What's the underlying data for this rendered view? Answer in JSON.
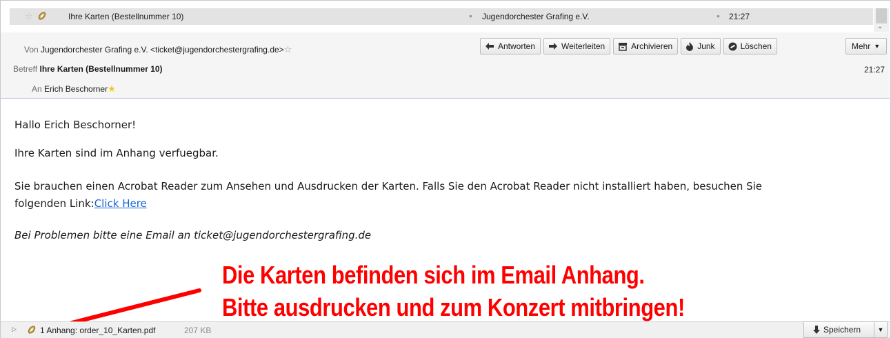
{
  "message_list": {
    "subject": "Ihre Karten (Bestellnummer 10)",
    "from": "Jugendorchester Grafing e.V.",
    "time": "21:27"
  },
  "header": {
    "from_label": "Von",
    "from_value": "Jugendorchester Grafing e.V. <ticket@jugendorchestergrafing.de>",
    "subject_label": "Betreff",
    "subject_value": "Ihre Karten (Bestellnummer 10)",
    "to_label": "An",
    "to_value": "Erich Beschorner",
    "time": "21:27"
  },
  "toolbar": {
    "reply": "Antworten",
    "forward": "Weiterleiten",
    "archive": "Archivieren",
    "junk": "Junk",
    "delete": "Löschen",
    "more": "Mehr"
  },
  "body": {
    "greeting": "Hallo Erich Beschorner!",
    "line1": "Ihre Karten sind im Anhang verfuegbar.",
    "line2a": "Sie brauchen einen Acrobat Reader zum Ansehen und Ausdrucken der Karten. Falls Sie den Acrobat Reader nicht installiert haben, besuchen Sie",
    "line2b": "folgenden Link:",
    "link_text": "Click Here",
    "problem": "Bei Problemen bitte eine Email an ticket@jugendorchestergrafing.de"
  },
  "annotation": {
    "line1": "Die Karten befinden sich im Email Anhang.",
    "line2": "Bitte ausdrucken und zum Konzert mitbringen!",
    "color": "#ff0000"
  },
  "attachments": {
    "label": "1 Anhang: order_10_Karten.pdf",
    "size": "207 KB",
    "save": "Speichern"
  },
  "icons": {
    "star": "star-icon",
    "attachment": "paperclip-icon",
    "reply": "reply-arrow-icon",
    "forward": "forward-arrow-icon",
    "archive": "archive-box-icon",
    "junk": "junk-flame-icon",
    "delete": "delete-circle-icon",
    "save": "download-arrow-icon"
  }
}
